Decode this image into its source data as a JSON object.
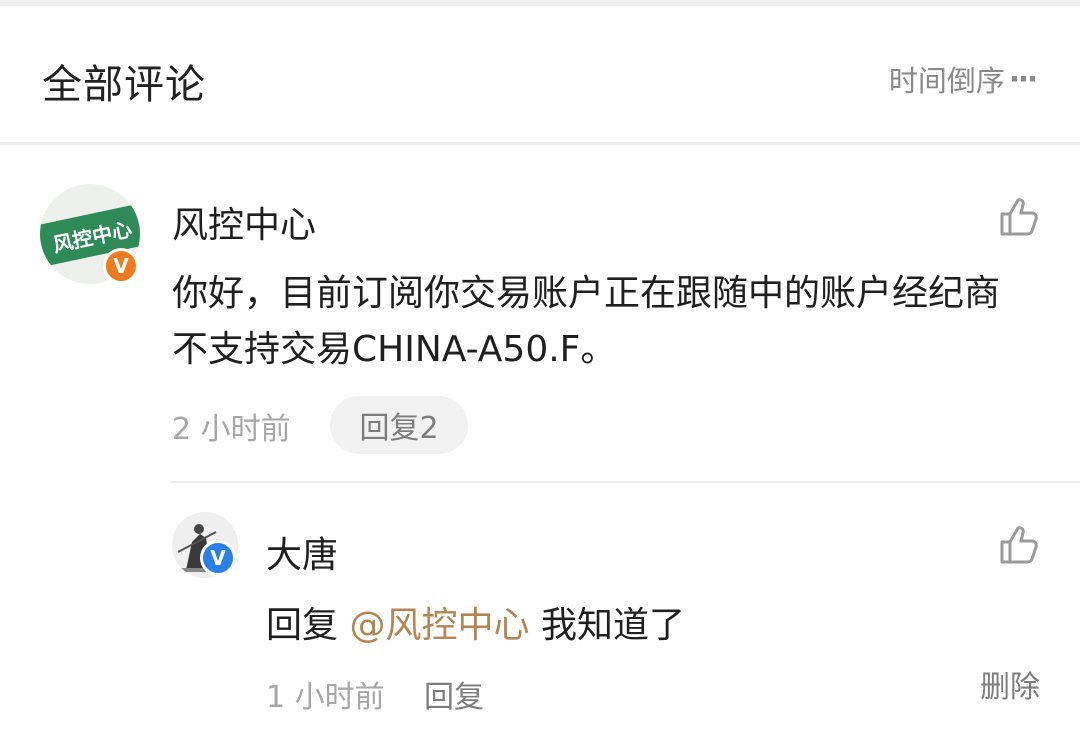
{
  "header": {
    "title": "全部评论",
    "sort_label": "时间倒序",
    "more_glyph": "···"
  },
  "comment": {
    "avatar_text": "风控中心",
    "badge": "V",
    "author": "风控中心",
    "text": "你好，目前订阅你交易账户正在跟随中的账户经纪商不支持交易CHINA-A50.F。",
    "time": "2 小时前",
    "reply_button": "回复2",
    "like_icon": "thumbs-up-icon"
  },
  "reply": {
    "badge": "V",
    "author": "大唐",
    "prefix": "回复",
    "mention": "@风控中心",
    "text": "我知道了",
    "time": "1 小时前",
    "reply_button": "回复",
    "delete_button": "删除",
    "like_icon": "thumbs-up-icon"
  },
  "colors": {
    "mention": "#b48552",
    "badge_orange": "#f07a1e",
    "badge_blue": "#2b7fe8",
    "avatar_green": "#2e8b57"
  }
}
